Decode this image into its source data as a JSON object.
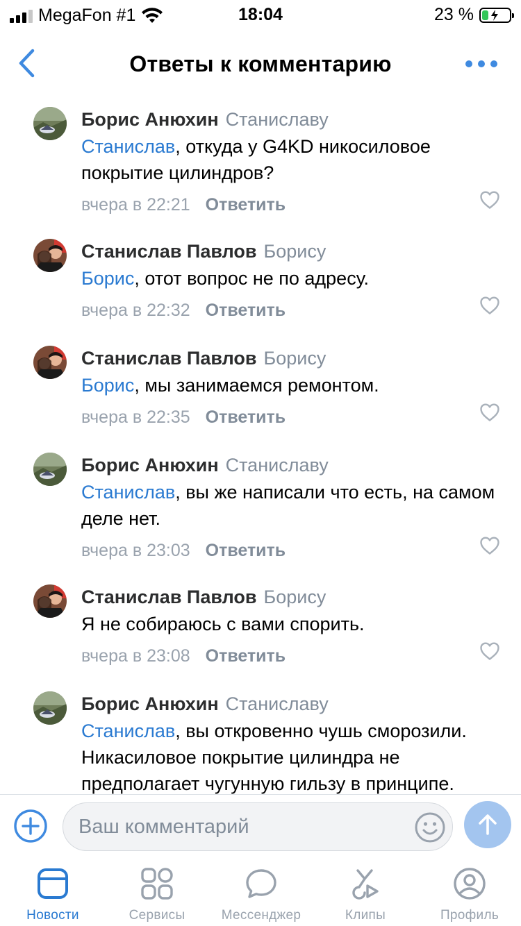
{
  "status_bar": {
    "carrier": "MegaFon #1",
    "time": "18:04",
    "battery_percent": "23 %",
    "battery_level": 0.23
  },
  "nav": {
    "title": "Ответы к комментарию"
  },
  "comments": [
    {
      "author": "Борис Анюхин",
      "reply_to": "Станиславу",
      "mention": "Станислав",
      "text": ", откуда у G4KD никосиловое покрытие цилиндров?",
      "time": "вчера в 22:21",
      "reply_label": "Ответить"
    },
    {
      "author": "Станислав Павлов",
      "reply_to": "Борису",
      "mention": "Борис",
      "text": ", отот вопрос не по адресу.",
      "time": "вчера в 22:32",
      "reply_label": "Ответить"
    },
    {
      "author": "Станислав Павлов",
      "reply_to": "Борису",
      "mention": "Борис",
      "text": ", мы занимаемся ремонтом.",
      "time": "вчера в 22:35",
      "reply_label": "Ответить"
    },
    {
      "author": "Борис Анюхин",
      "reply_to": "Станиславу",
      "mention": "Станислав",
      "text": ", вы же написали что есть, на самом деле нет.",
      "time": "вчера в 23:03",
      "reply_label": "Ответить"
    },
    {
      "author": "Станислав Павлов",
      "reply_to": "Борису",
      "mention": "",
      "text": "Я не собираюсь с вами спорить.",
      "time": "вчера в 23:08",
      "reply_label": "Ответить"
    },
    {
      "author": "Борис Анюхин",
      "reply_to": "Станиславу",
      "mention": "Станислав",
      "text": ", вы откровенно чушь сморозили. Никасиловое покрытие цилиндра не предполагает чугунную гильзу в принципе.",
      "time": "",
      "reply_label": ""
    }
  ],
  "input": {
    "placeholder": "Ваш комментарий"
  },
  "tabs": [
    {
      "label": "Новости",
      "icon": "news-icon",
      "active": true
    },
    {
      "label": "Сервисы",
      "icon": "services-icon",
      "active": false
    },
    {
      "label": "Мессенджер",
      "icon": "messenger-icon",
      "active": false
    },
    {
      "label": "Клипы",
      "icon": "clips-icon",
      "active": false
    },
    {
      "label": "Профиль",
      "icon": "profile-icon",
      "active": false
    }
  ],
  "colors": {
    "accent": "#2a7ad1",
    "accent_light": "#3f8ae0",
    "muted": "#818c99",
    "send_disabled": "#a3c5ef"
  }
}
